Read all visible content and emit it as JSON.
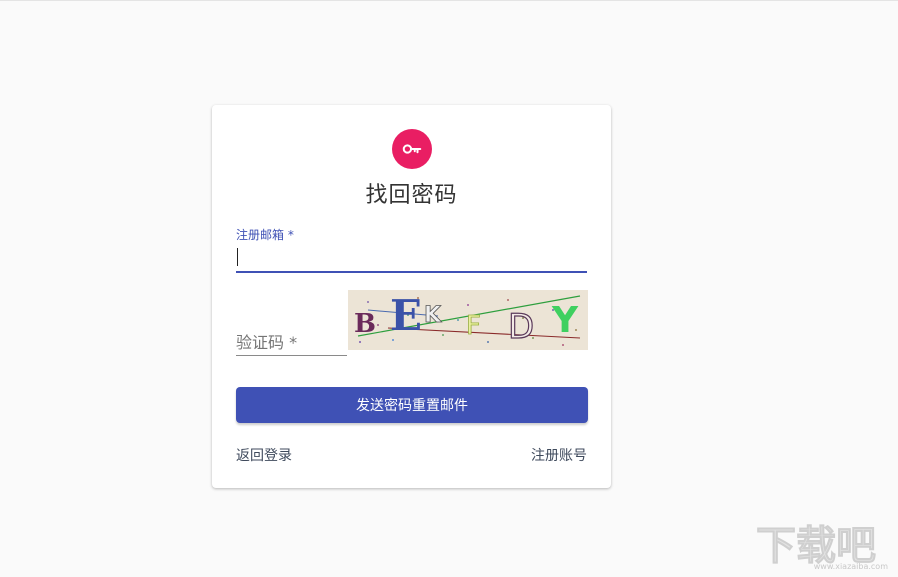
{
  "page": {
    "title": "找回密码"
  },
  "form": {
    "email_label": "注册邮箱",
    "required_mark": " *",
    "email_value": "",
    "captcha_label": "验证码 *",
    "captcha_value": "",
    "captcha_text": [
      "B",
      "E",
      "K",
      "F",
      "D",
      "Y"
    ],
    "submit_label": "发送密码重置邮件"
  },
  "links": {
    "back_to_login": "返回登录",
    "register": "注册账号"
  },
  "icons": {
    "avatar": "key-icon"
  },
  "colors": {
    "primary": "#3f51b5",
    "accent": "#e91e63"
  },
  "watermark": {
    "text": "下载吧",
    "url": "www.xiazaiba.com"
  }
}
